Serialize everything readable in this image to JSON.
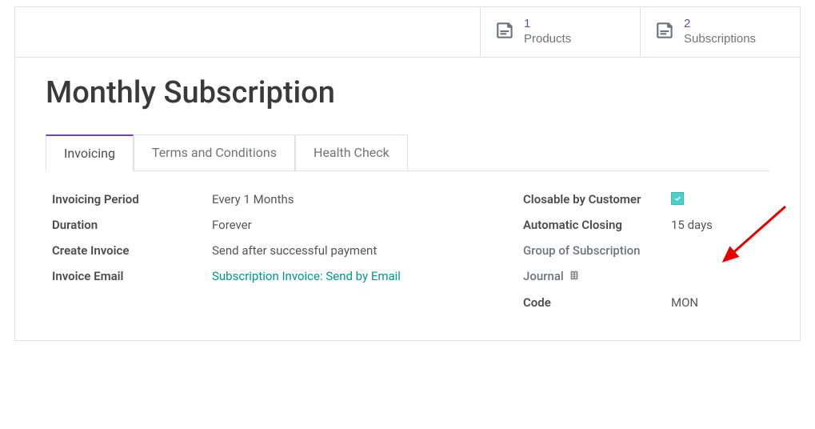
{
  "statButtons": {
    "products": {
      "count": "1",
      "label": "Products"
    },
    "subscriptions": {
      "count": "2",
      "label": "Subscriptions"
    }
  },
  "title": "Monthly Subscription",
  "tabs": {
    "invoicing": "Invoicing",
    "terms": "Terms and Conditions",
    "health": "Health Check"
  },
  "fields": {
    "invoicingPeriod": {
      "label": "Invoicing Period",
      "value": "Every  1  Months"
    },
    "duration": {
      "label": "Duration",
      "value": "Forever"
    },
    "createInvoice": {
      "label": "Create Invoice",
      "value": "Send after successful payment"
    },
    "invoiceEmail": {
      "label": "Invoice Email",
      "value": "Subscription Invoice: Send by Email"
    },
    "closable": {
      "label": "Closable by Customer"
    },
    "autoClosing": {
      "label": "Automatic Closing",
      "value": "15  days"
    },
    "groupSub": {
      "label": "Group of Subscription"
    },
    "journal": {
      "label": "Journal"
    },
    "code": {
      "label": "Code",
      "value": "MON"
    }
  }
}
